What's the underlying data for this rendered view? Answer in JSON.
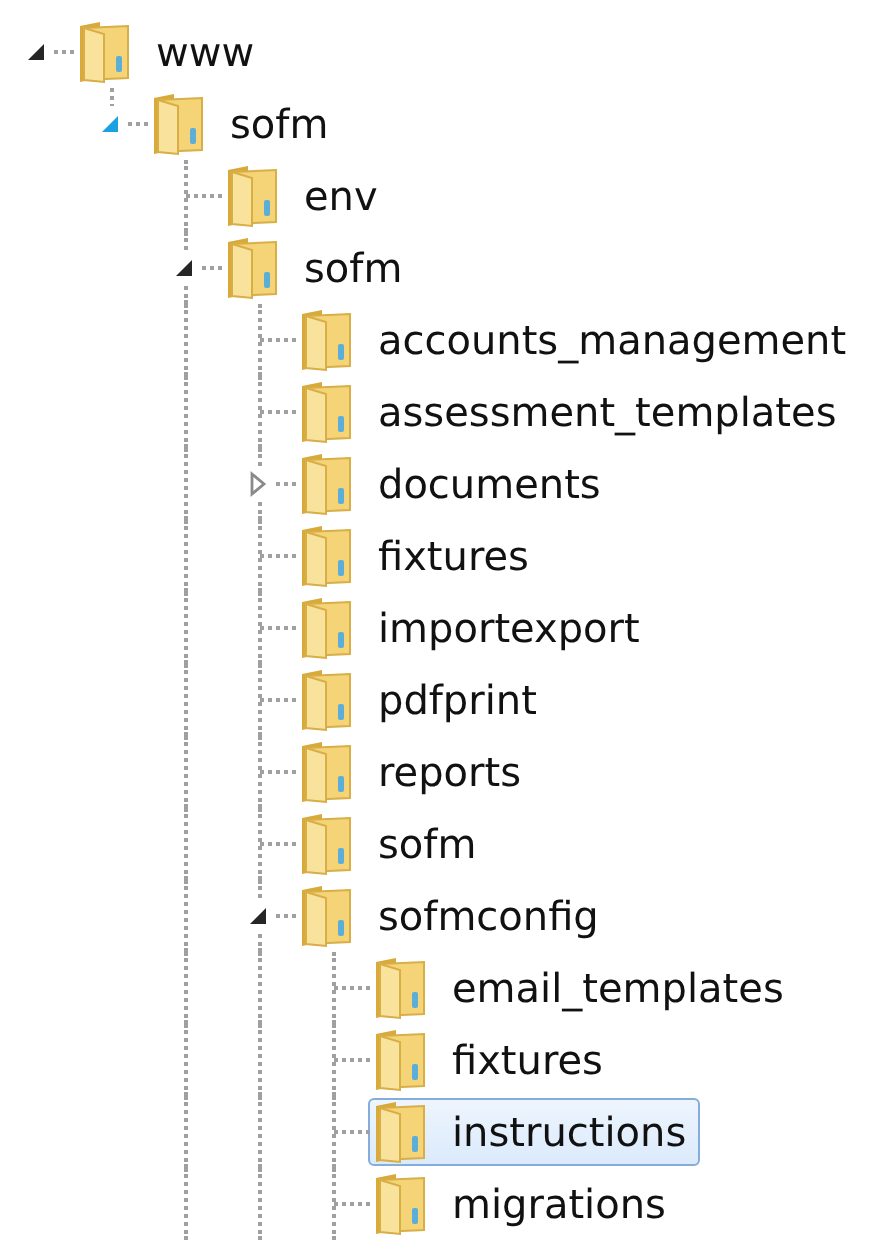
{
  "tree": [
    {
      "label": "www",
      "expanded": true,
      "hovered": false,
      "selected": false,
      "children": [
        {
          "label": "sofm",
          "expanded": true,
          "hovered": true,
          "selected": false,
          "children": [
            {
              "label": "env",
              "selected": false
            },
            {
              "label": "sofm",
              "expanded": true,
              "hovered": false,
              "selected": false,
              "children": [
                {
                  "label": "accounts_management",
                  "selected": false
                },
                {
                  "label": "assessment_templates",
                  "selected": false
                },
                {
                  "label": "documents",
                  "expanded": false,
                  "hovered": false,
                  "selected": false
                },
                {
                  "label": "fixtures",
                  "selected": false
                },
                {
                  "label": "importexport",
                  "selected": false
                },
                {
                  "label": "pdfprint",
                  "selected": false
                },
                {
                  "label": "reports",
                  "selected": false
                },
                {
                  "label": "sofm",
                  "selected": false
                },
                {
                  "label": "sofmconfig",
                  "expanded": true,
                  "hovered": false,
                  "selected": false,
                  "children": [
                    {
                      "label": "email_templates",
                      "selected": false
                    },
                    {
                      "label": "fixtures",
                      "selected": false
                    },
                    {
                      "label": "instructions",
                      "selected": true
                    },
                    {
                      "label": "migrations",
                      "selected": false
                    }
                  ]
                }
              ]
            }
          ]
        }
      ]
    }
  ]
}
